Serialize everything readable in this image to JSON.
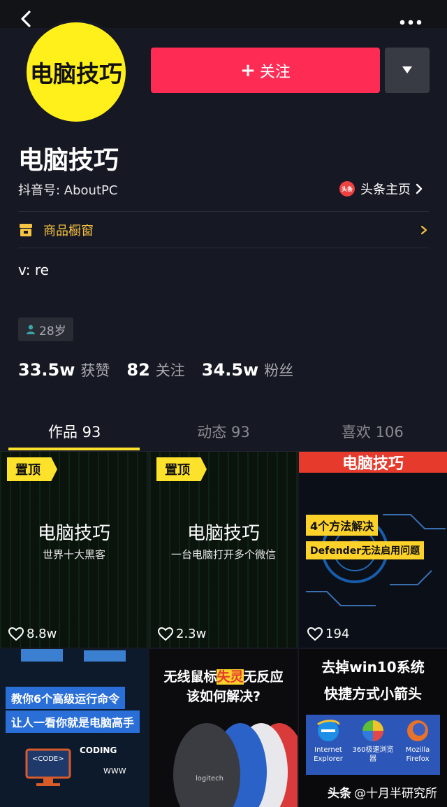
{
  "profile": {
    "avatar_text": "电脑技巧",
    "name": "电脑技巧",
    "douyin_id": "抖音号: AboutPC",
    "toutiao_badge": "头条",
    "toutiao_link": "头条主页",
    "follow_label": "关注",
    "follow_plus": "+",
    "shop_label": "商品橱窗",
    "bio": "v: re",
    "age": "28岁"
  },
  "stats": [
    {
      "value": "33.5w",
      "label": "获赞"
    },
    {
      "value": "82",
      "label": "关注"
    },
    {
      "value": "34.5w",
      "label": "粉丝"
    }
  ],
  "tabs": [
    {
      "label": "作品 93",
      "active": true
    },
    {
      "label": "动态 93",
      "active": false
    },
    {
      "label": "喜欢 106",
      "active": false
    }
  ],
  "videos": [
    {
      "pinned": "置顶",
      "title": "电脑技巧",
      "subtitle": "世界十大黑客",
      "likes": "8.8w"
    },
    {
      "pinned": "置顶",
      "title": "电脑技巧",
      "subtitle": "一台电脑打开多个微信",
      "likes": "2.3w"
    },
    {
      "header": "电脑技巧",
      "line1": "4个方法解决",
      "line2": "Defender无法启用问题",
      "likes": "194"
    },
    {
      "line1": "教你6个高级运行命令",
      "line2": "让人一看你就是电脑高手",
      "coding": "CODING",
      "code": "<CODE>",
      "www": "WWW"
    },
    {
      "title_a": "无线鼠标",
      "title_hl": "失灵",
      "title_b": "无反应",
      "title_line2": "该如何解决?",
      "brand": "logitech"
    },
    {
      "title_line1": "去掉win10系统",
      "title_line2": "快捷方式小箭头",
      "browsers": [
        {
          "name": "Internet Explorer"
        },
        {
          "name": "360极速浏览器"
        },
        {
          "name": "Mozilla Firefox"
        }
      ]
    }
  ],
  "watermark": {
    "source": "头条",
    "account": "@十月半研究所"
  },
  "colors": {
    "accent_red": "#fe2c55",
    "accent_yellow": "#fde22c",
    "background": "#161823"
  }
}
